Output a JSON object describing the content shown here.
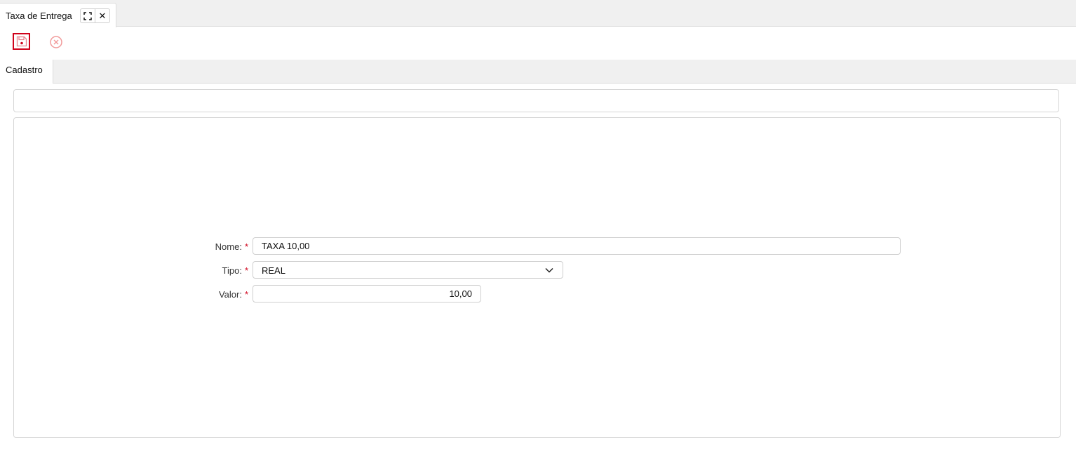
{
  "window_tab": {
    "title": "Taxa de Entrega",
    "expand_icon": "expand-icon",
    "close_label": "✕"
  },
  "toolbar": {
    "save_icon": "floppy-disk-icon",
    "cancel_icon": "cancel-circle-icon",
    "accent_color": "#d0021b",
    "cancel_color": "#f19a9a"
  },
  "form_tabs": [
    {
      "label": "Cadastro"
    }
  ],
  "form": {
    "nome": {
      "label": "Nome:",
      "required": "*",
      "value": "TAXA 10,00"
    },
    "tipo": {
      "label": "Tipo:",
      "required": "*",
      "value": "REAL",
      "icon": "chevron-down-icon"
    },
    "valor": {
      "label": "Valor:",
      "required": "*",
      "value": "10,00"
    }
  }
}
